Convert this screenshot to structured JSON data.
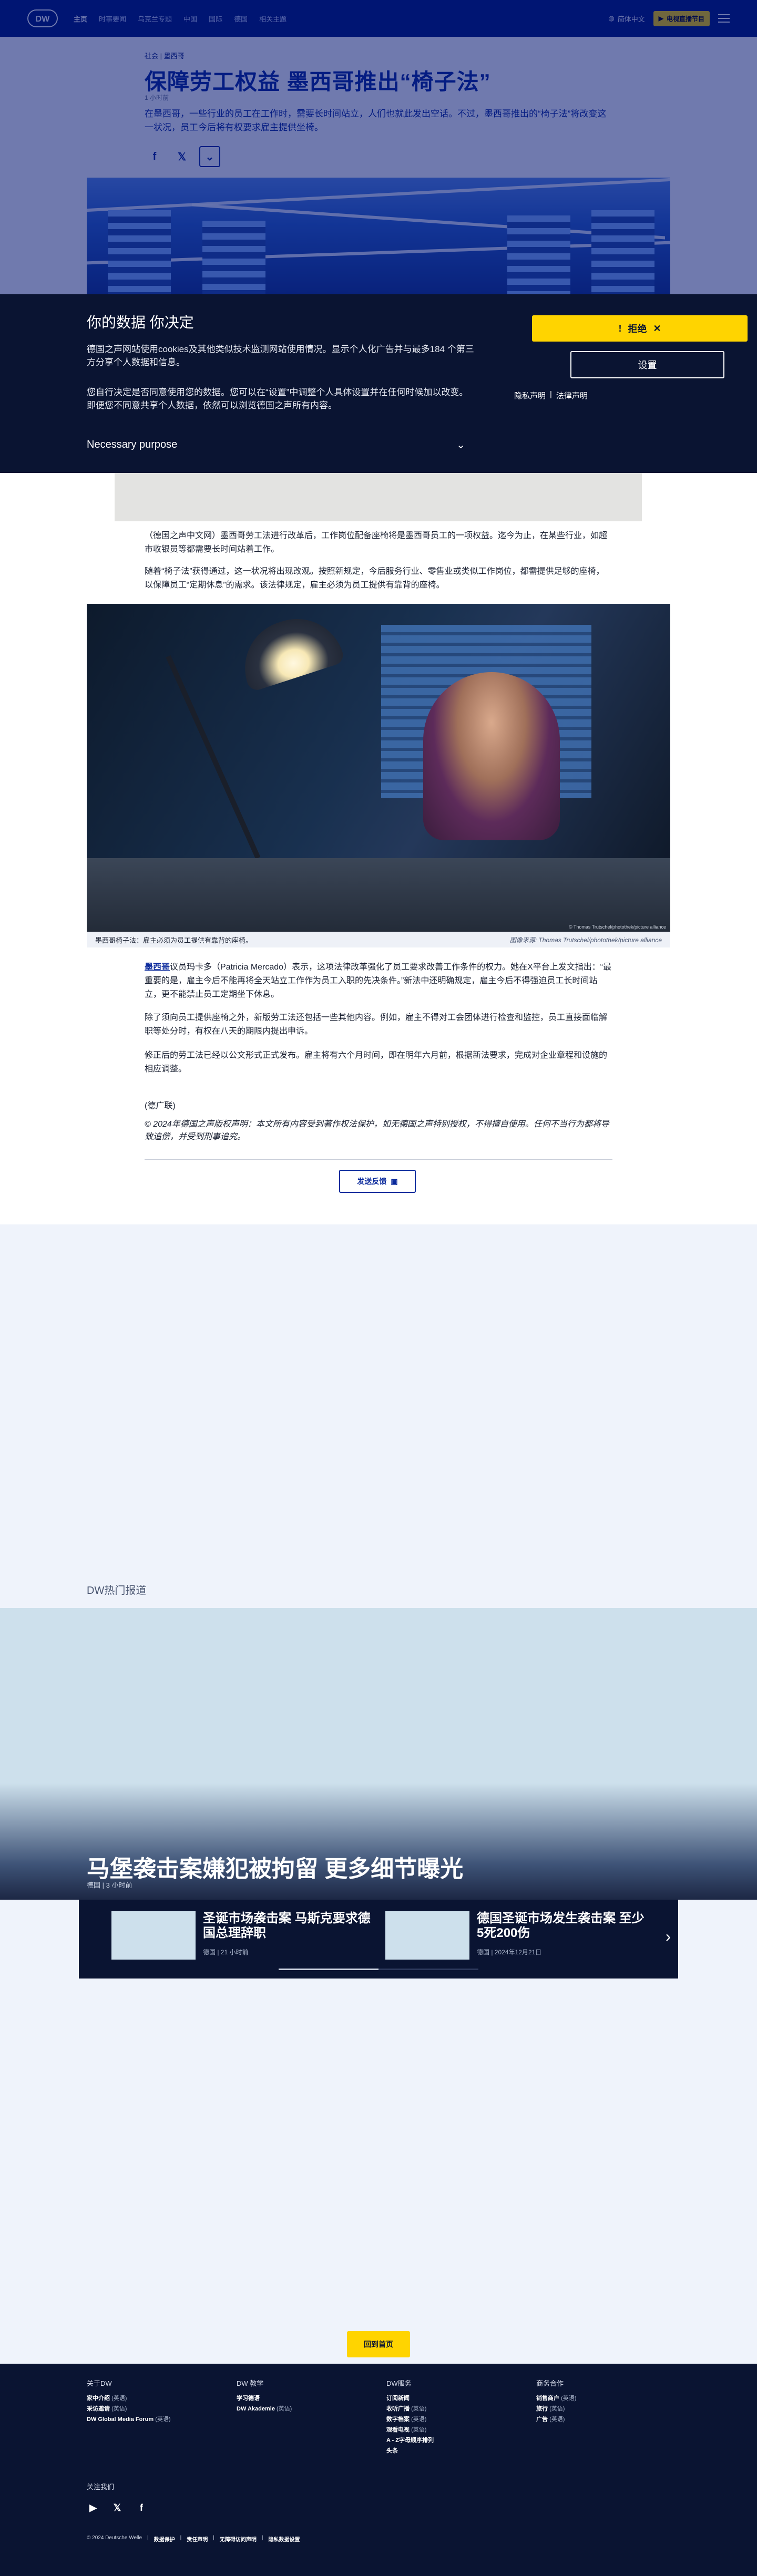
{
  "header": {
    "nav_items": [
      "主页",
      "时事要闻",
      "乌克兰专题",
      "中国",
      "国际",
      "德国"
    ],
    "nav_extra": "相关主题",
    "lang_label": "简体中文",
    "live_label": "电视直播节目"
  },
  "article": {
    "breadcrumb_section": "社会",
    "breadcrumb_region": "墨西哥",
    "title": "保障劳工权益 墨西哥推出“椅子法”",
    "date": "1 小时前",
    "lead": "在墨西哥，一些行业的员工在工作时，需要长时间站立，人们也就此发出空话。不过，墨西哥推出的“椅子法”将改变这一状况，员工今后将有权要求雇主提供坐椅。",
    "paragraphs": [
      "（德国之声中文网）墨西哥劳工法进行改革后，工作岗位配备座椅将是墨西哥员工的一项权益。迄今为止，在某些行业，如超市收银员等都需要长时间站着工作。",
      "随着“椅子法”获得通过，这一状况将出现改观。按照新规定，今后服务行业、零售业或类似工作岗位，都需提供足够的座椅，以保障员工“定期休息”的需求。该法律规定，雇主必须为员工提供有靠背的座椅。"
    ],
    "photo_caption": "墨西哥椅子法：雇主必须为员工提供有靠背的座椅。",
    "photo_credit": "图像来源: Thomas Trutschel/photothek/picture alliance",
    "photo_inner_credit": "© Thomas Trutschel/photothek/picture alliance",
    "body_highlight": "墨西哥",
    "body_para_1": "议员玛卡多（Patricia Mercado）表示，这项法律改革强化了员工要求改善工作条件的权力。她在X平台上发文指出：“最重要的是，雇主今后不能再将全天站立工作作为员工入职的先决条件。”新法中还明确规定，雇主今后不得强迫员工长时间站立，更不能禁止员工定期坐下休息。",
    "body_para_2": "除了须向员工提供座椅之外，新版劳工法还包括一些其他内容。例如，雇主不得对工会团体进行检查和监控，员工直接面临解职等处分时，有权在八天的期限内提出申诉。",
    "body_para_3": "修正后的劳工法已经以公文形式正式发布。雇主将有六个月时间，即在明年六月前，根据新法要求，完成对企业章程和设施的相应调整。",
    "signature": "(德广联)",
    "copyright": "© 2024年德国之声版权声明：本文所有内容受到著作权法保护，如无德国之声特别授权，不得擅自使用。任何不当行为都将导致追偿，并受到刑事追究。",
    "feedback_label": "发送反馈"
  },
  "consent": {
    "title": "你的数据 你决定",
    "p1": "德国之声网站使用cookies及其他类似技术监测网站使用情况。显示个人化广告并与最多184 个第三方分享个人数据和信息。",
    "p2": "您自行决定是否同意使用您的数据。您可以在“设置”中调整个人具体设置并在任何时候加以改变。即便您不同意共享个人数据，依然可以浏览德国之声所有内容。",
    "purpose_label": "Necessary purpose",
    "reject_label": "拒绝",
    "settings_label": "设置",
    "privacy_label": "隐私声明",
    "legal_label": "法律声明"
  },
  "hot": {
    "section_label": "DW热门报道",
    "feature_title": "马堡袭击案嫌犯被拘留 更多细节曝光",
    "feature_meta": "德国 | 3 小时前",
    "cards": [
      {
        "title": "圣诞市场袭击案 马斯克要求德国总理辞职",
        "meta": "德国 | 21 小时前"
      },
      {
        "title": "德国圣诞市场发生袭击案 至少5死200伤",
        "meta": "德国 | 2024年12月21日"
      }
    ]
  },
  "footer": {
    "back_top": "回到首页",
    "columns": [
      {
        "heading": "关于DW",
        "items": [
          {
            "t": "家中介绍",
            "e": "(英语)"
          },
          {
            "t": "采访邀请",
            "e": "(英语)"
          },
          {
            "t": "DW Global Media Forum",
            "e": "(英语)"
          }
        ]
      },
      {
        "heading": "DW 教学",
        "items": [
          {
            "t": "学习德语",
            "e": ""
          },
          {
            "t": "DW Akademie",
            "e": "(英语)"
          }
        ]
      },
      {
        "heading": "DW服务",
        "items": [
          {
            "t": "订阅新闻",
            "e": ""
          },
          {
            "t": "收听广播",
            "e": "(英语)"
          },
          {
            "t": "数字档案",
            "e": "(英语)"
          },
          {
            "t": "观看电视",
            "e": "(英语)"
          },
          {
            "t": "A - Z字母顺序排列",
            "e": ""
          },
          {
            "t": "头条",
            "e": ""
          }
        ]
      },
      {
        "heading": "商务合作",
        "items": [
          {
            "t": "销售商户",
            "e": "(英语)"
          },
          {
            "t": "旅行",
            "e": "(英语)"
          },
          {
            "t": "广告",
            "e": "(英语)"
          }
        ]
      }
    ],
    "follow_label": "关注我们",
    "bottom_links": [
      "© 2024 Deutsche Welle",
      "数据保护",
      "责任声明",
      "无障碍访问声明",
      "隐私数据设置"
    ]
  },
  "colors": {
    "brand": "#001a7a",
    "accent": "#ffd400",
    "banner": "#0a1432"
  }
}
